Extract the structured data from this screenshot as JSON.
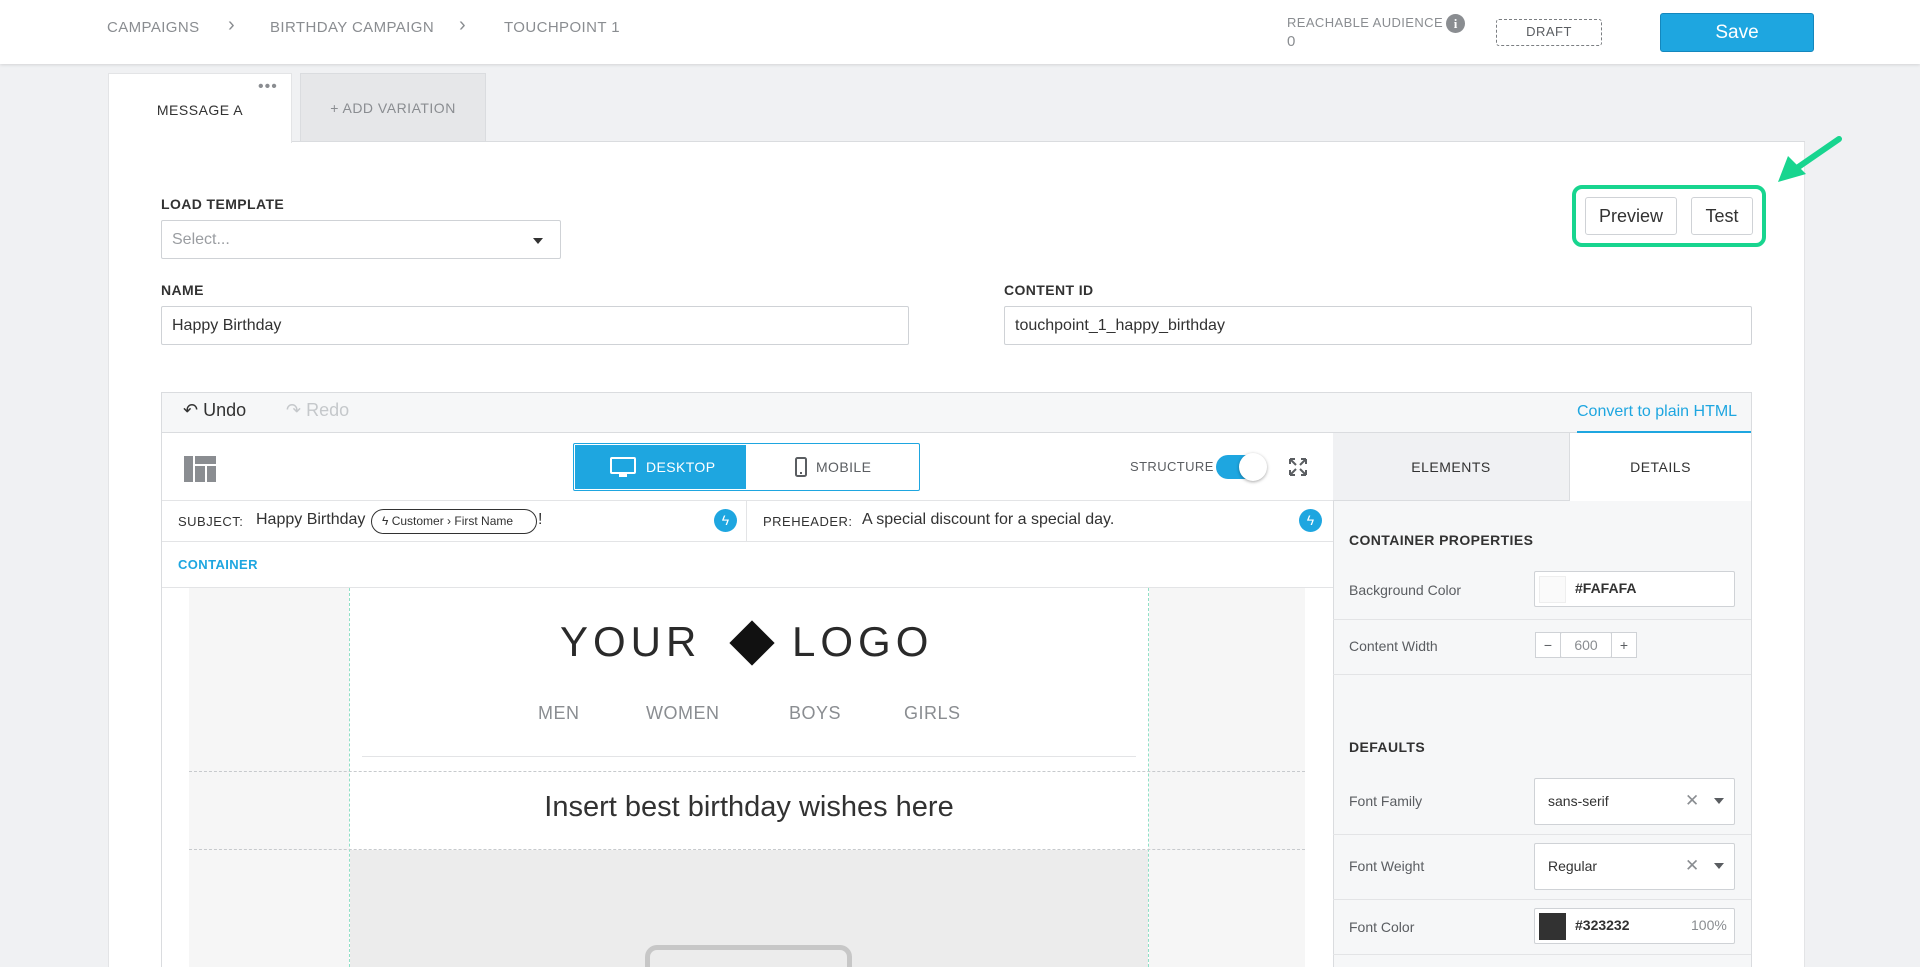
{
  "breadcrumb": [
    "CAMPAIGNS",
    "BIRTHDAY CAMPAIGN",
    "TOUCHPOINT 1"
  ],
  "audience": {
    "label": "REACHABLE AUDIENCE",
    "value": "0"
  },
  "status_badge": "DRAFT",
  "save_label": "Save",
  "tabs": {
    "message_a": "MESSAGE A",
    "add_variation": "+ ADD VARIATION"
  },
  "form": {
    "load_template_label": "LOAD TEMPLATE",
    "load_template_placeholder": "Select...",
    "name_label": "NAME",
    "name_value": "Happy Birthday",
    "content_id_label": "CONTENT ID",
    "content_id_value": "touchpoint_1_happy_birthday"
  },
  "actions": {
    "preview": "Preview",
    "test": "Test"
  },
  "editor": {
    "undo": "Undo",
    "redo": "Redo",
    "convert": "Convert to plain HTML",
    "desktop": "DESKTOP",
    "mobile": "MOBILE",
    "structure": "STRUCTURE",
    "subject_label": "SUBJECT:",
    "subject_text": "Happy Birthday",
    "subject_pill": "Customer › First Name",
    "subject_suffix": "!",
    "preheader_label": "PREHEADER:",
    "preheader_text": "A special discount for a special day.",
    "container_label": "CONTAINER"
  },
  "email": {
    "logo_left": "YOUR",
    "logo_right": "LOGO",
    "nav": [
      "MEN",
      "WOMEN",
      "BOYS",
      "GIRLS"
    ],
    "wishes": "Insert best birthday wishes here"
  },
  "panel": {
    "tab_elements": "ELEMENTS",
    "tab_details": "DETAILS",
    "container_properties": "CONTAINER PROPERTIES",
    "bg_color_label": "Background Color",
    "bg_color_value": "#FAFAFA",
    "content_width_label": "Content Width",
    "content_width_value": "600",
    "defaults": "DEFAULTS",
    "font_family_label": "Font Family",
    "font_family_value": "sans-serif",
    "font_weight_label": "Font Weight",
    "font_weight_value": "Regular",
    "font_color_label": "Font Color",
    "font_color_value": "#323232",
    "font_color_opacity": "100%"
  },
  "colors": {
    "accent": "#1ea6e0",
    "highlight": "#18d58f",
    "bg_swatch": "#FAFAFA",
    "font_swatch": "#323232"
  }
}
